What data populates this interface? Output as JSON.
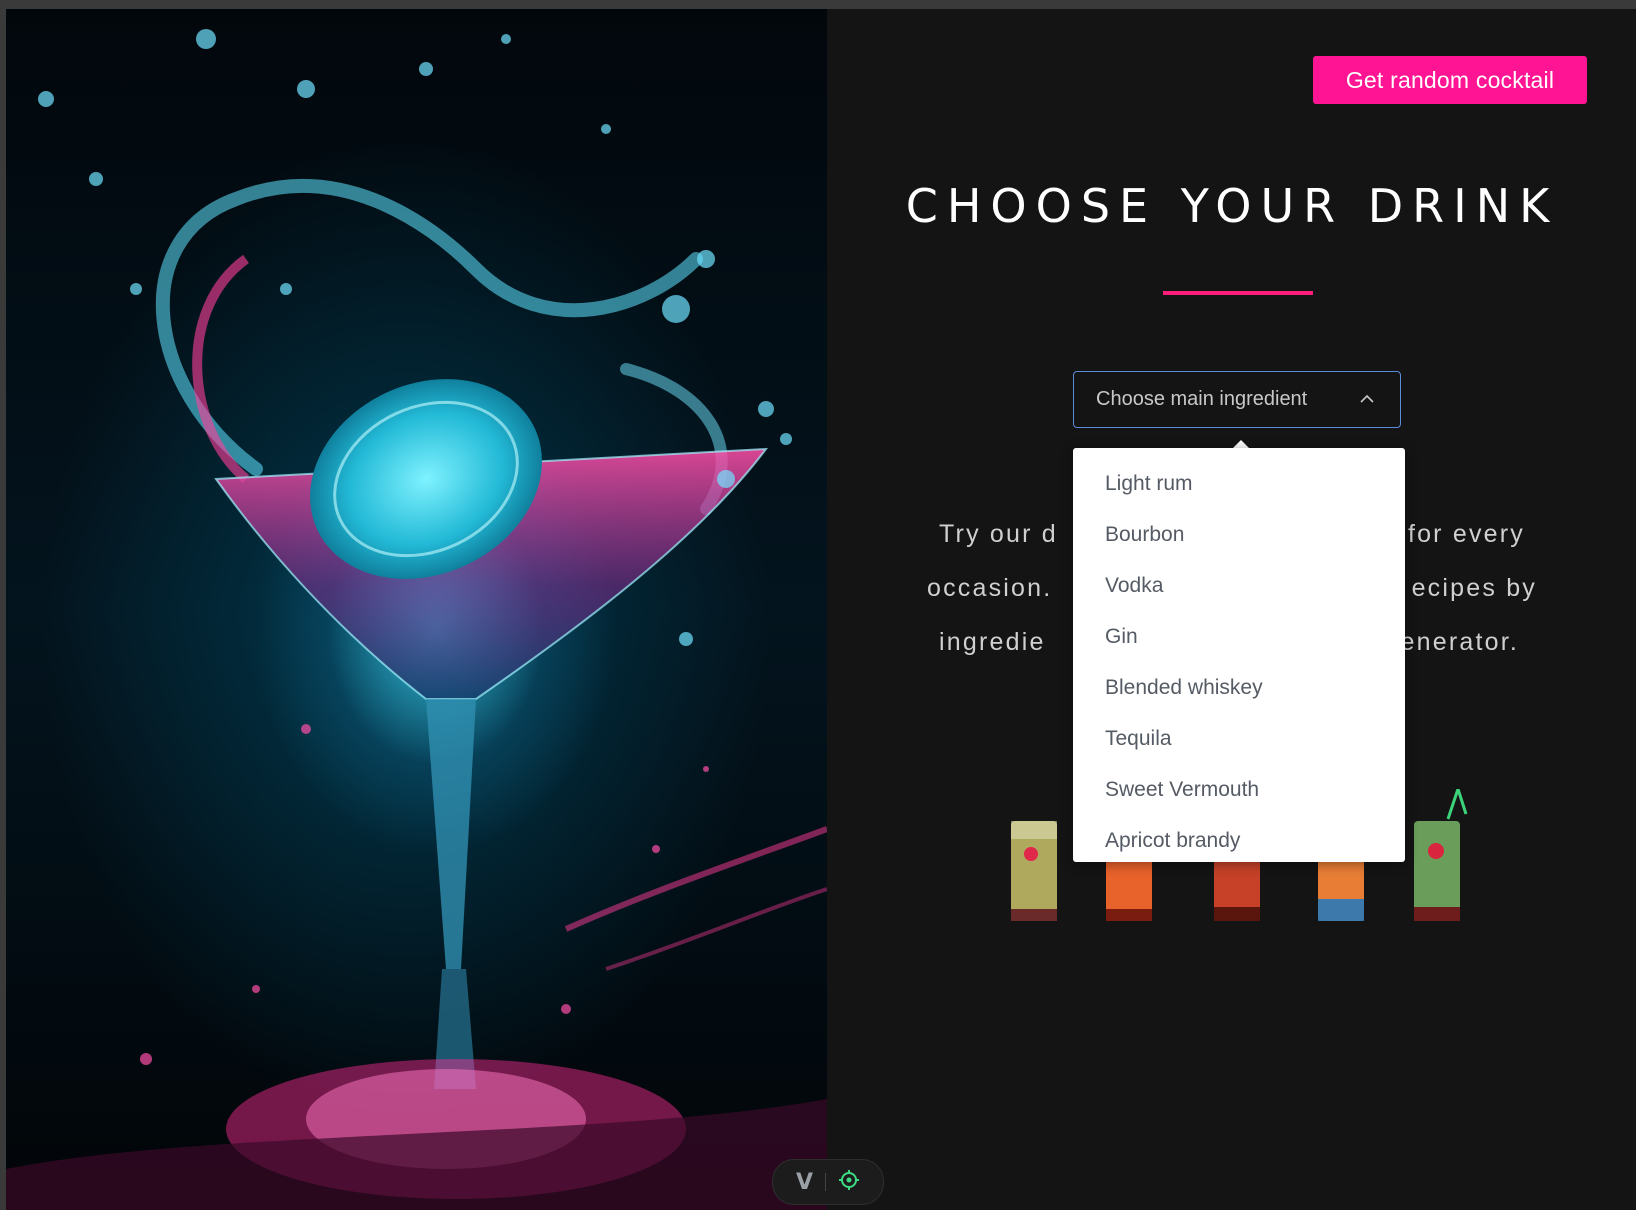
{
  "header": {
    "random_button_label": "Get random cocktail"
  },
  "main": {
    "title": "CHOOSE YOUR DRINK",
    "select": {
      "placeholder": "Choose main ingredient"
    },
    "description_lines": [
      "Try our d",
      "for every",
      "occasion.",
      "ecipes by",
      "ingredie",
      "enerator."
    ]
  },
  "dropdown": {
    "options": [
      "Light rum",
      "Bourbon",
      "Vodka",
      "Gin",
      "Blended whiskey",
      "Tequila",
      "Sweet Vermouth",
      "Apricot brandy"
    ]
  },
  "toolbar": {
    "logo_letter": "V"
  },
  "colors": {
    "accent": "#ff1493",
    "select_border": "#5b8cd9",
    "background": "#141414"
  }
}
